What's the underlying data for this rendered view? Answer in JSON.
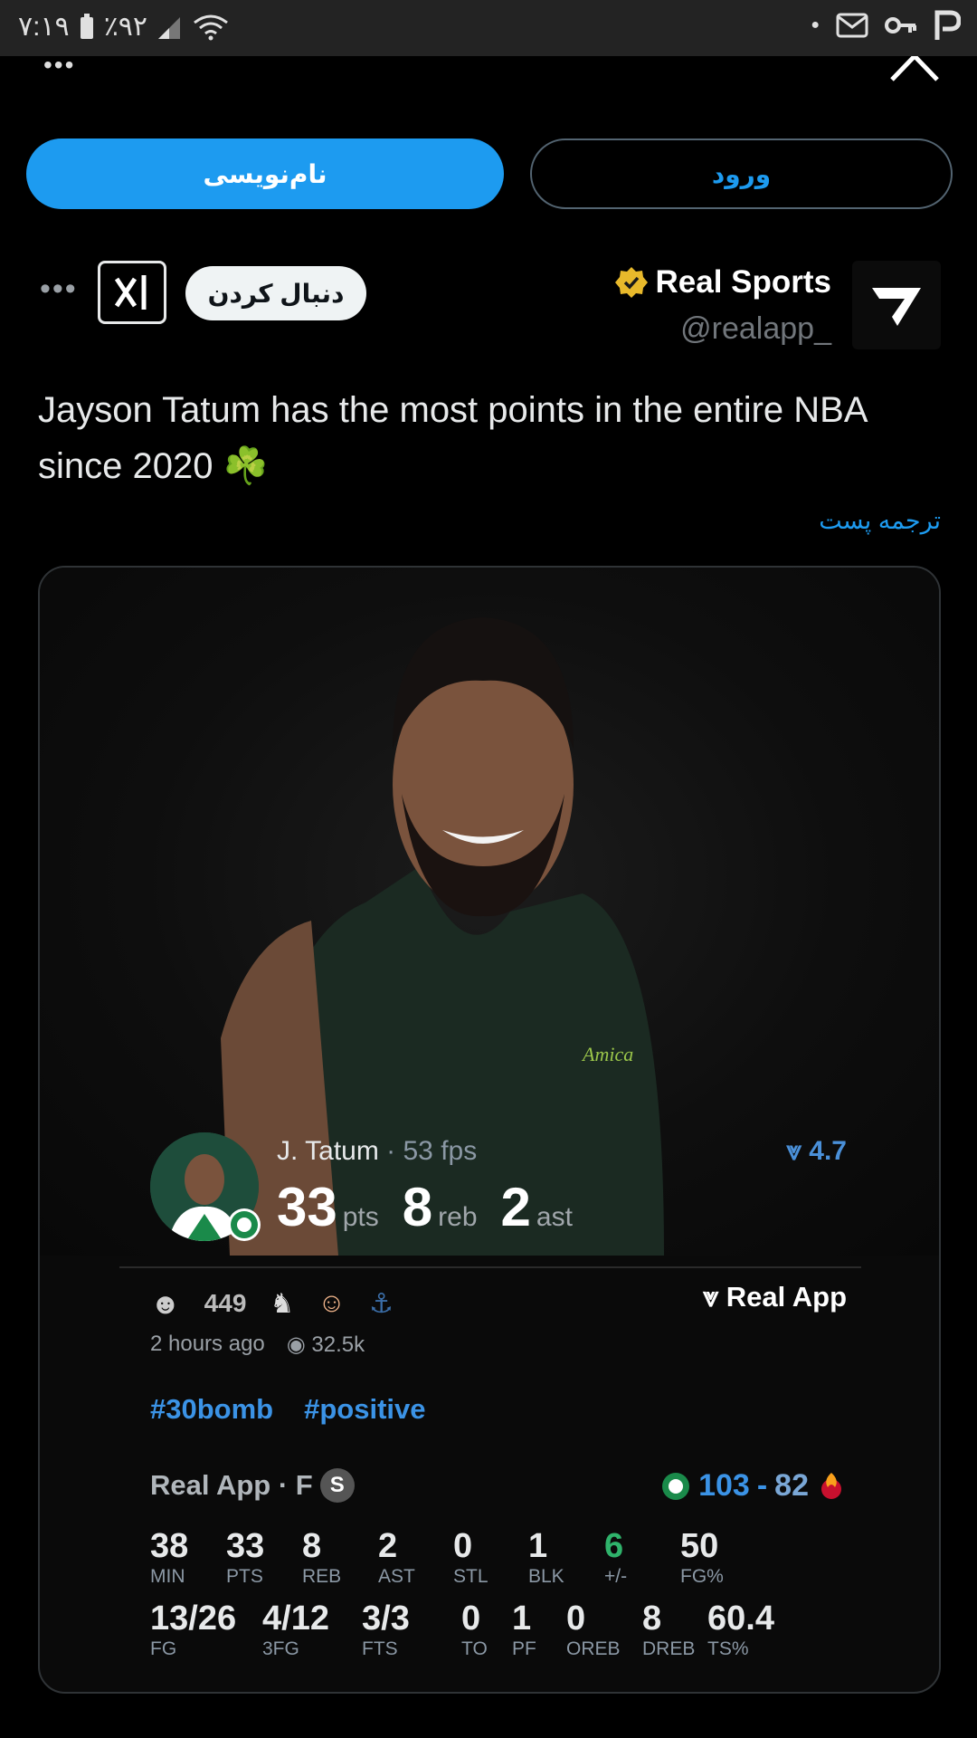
{
  "status_bar": {
    "time": "۷:۱۹",
    "battery": "٪۹۲"
  },
  "auth": {
    "login_label": "ورود",
    "signup_label": "نام‌نویسی"
  },
  "author": {
    "name": "Real Sports",
    "handle": "@realapp_",
    "follow_label": "دنبال کردن"
  },
  "tweet": {
    "text": "Jayson Tatum has the most points in the entire NBA since 2020 ☘️",
    "translate_label": "ترجمه پست"
  },
  "card": {
    "player": {
      "name": "J. Tatum",
      "fps": "· 53 fps",
      "rating": "4.7"
    },
    "big_stats": [
      {
        "value": "33",
        "label": "pts"
      },
      {
        "value": "8",
        "label": "reb"
      },
      {
        "value": "2",
        "label": "ast"
      }
    ],
    "reactions": {
      "count": "449",
      "brand": "Real App"
    },
    "meta": {
      "time_ago": "2 hours ago",
      "views": "32.5k"
    },
    "hashtags": [
      "#30bomb",
      "#positive"
    ],
    "game": {
      "label": "Real App · F",
      "badge": "S",
      "home_score": "103",
      "sep": "-",
      "away_score": "82"
    },
    "stats_row1": [
      {
        "v": "38",
        "l": "MIN"
      },
      {
        "v": "33",
        "l": "PTS"
      },
      {
        "v": "8",
        "l": "REB"
      },
      {
        "v": "2",
        "l": "AST"
      },
      {
        "v": "0",
        "l": "STL"
      },
      {
        "v": "1",
        "l": "BLK"
      },
      {
        "v": "6",
        "l": "+/-"
      },
      {
        "v": "50",
        "l": "FG%"
      }
    ],
    "stats_row2": [
      {
        "v": "13/26",
        "l": "FG"
      },
      {
        "v": "4/12",
        "l": "3FG"
      },
      {
        "v": "3/3",
        "l": "FTS"
      },
      {
        "v": "0",
        "l": "TO"
      },
      {
        "v": "1",
        "l": "PF"
      },
      {
        "v": "0",
        "l": "OREB"
      },
      {
        "v": "8",
        "l": "DREB"
      },
      {
        "v": "60.4",
        "l": "TS%"
      }
    ]
  },
  "colors": {
    "accent": "#1d9bf0",
    "plus_minus": "#2fb36b",
    "verified": "#e8b92b"
  }
}
